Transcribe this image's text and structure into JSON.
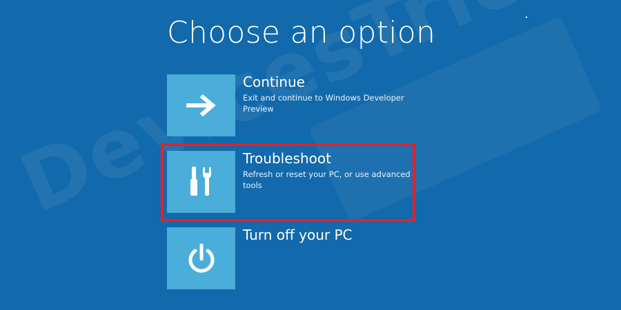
{
  "screen": {
    "title": "Choose an option",
    "background_color": "#1269ab",
    "tile_color": "#4badd9",
    "highlight_color": "#e3202b"
  },
  "options": [
    {
      "title": "Continue",
      "description": "Exit and continue to Windows Developer Preview",
      "icon": "arrow-right-icon"
    },
    {
      "title": "Troubleshoot",
      "description": "Refresh or reset your PC, or use advanced tools",
      "icon": "tools-icon",
      "highlighted": true
    },
    {
      "title": "Turn off your PC",
      "description": "",
      "icon": "power-icon"
    }
  ],
  "watermark": {
    "text": "DevicesTricks"
  }
}
